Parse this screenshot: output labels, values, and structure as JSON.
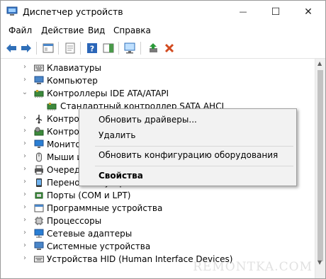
{
  "window": {
    "title": "Диспетчер устройств",
    "minimize": "—",
    "maximize": "☐",
    "close": "✕"
  },
  "menu": [
    "Файл",
    "Действие",
    "Вид",
    "Справка"
  ],
  "tree": [
    {
      "label": "Клавиатуры",
      "state": "collapsed",
      "icon": "keyboard-icon"
    },
    {
      "label": "Компьютер",
      "state": "collapsed",
      "icon": "computer-icon"
    },
    {
      "label": "Контроллеры IDE ATA/ATAPI",
      "state": "expanded",
      "icon": "ide-controller-icon"
    },
    {
      "label": "Стандартный контроллер SATA AHCI",
      "state": "child",
      "icon": "sata-controller-icon"
    },
    {
      "label": "Контроллеры USB",
      "state": "collapsed",
      "icon": "usb-icon"
    },
    {
      "label": "Контроллеры запоминающих устройств",
      "state": "collapsed",
      "icon": "storage-controller-icon"
    },
    {
      "label": "Мониторы",
      "state": "collapsed",
      "icon": "monitor-icon"
    },
    {
      "label": "Мыши и иные указывающие устройства",
      "state": "collapsed",
      "icon": "mouse-icon"
    },
    {
      "label": "Очереди печати",
      "state": "collapsed",
      "icon": "printer-icon"
    },
    {
      "label": "Переносные устройства",
      "state": "collapsed",
      "icon": "portable-device-icon"
    },
    {
      "label": "Порты (COM и LPT)",
      "state": "collapsed",
      "icon": "port-icon"
    },
    {
      "label": "Программные устройства",
      "state": "collapsed",
      "icon": "software-device-icon"
    },
    {
      "label": "Процессоры",
      "state": "collapsed",
      "icon": "processor-icon"
    },
    {
      "label": "Сетевые адаптеры",
      "state": "collapsed",
      "icon": "network-adapter-icon"
    },
    {
      "label": "Системные устройства",
      "state": "collapsed",
      "icon": "system-device-icon"
    },
    {
      "label": "Устройства HID (Human Interface Devices)",
      "state": "collapsed",
      "icon": "hid-icon"
    }
  ],
  "context_menu": {
    "update_drivers": "Обновить драйверы...",
    "remove": "Удалить",
    "scan_hardware": "Обновить конфигурацию оборудования",
    "properties": "Свойства"
  },
  "watermark": "REMONTKA.COM",
  "colors": {
    "accent": "#1e7fd8",
    "remove_red": "#d24a1f",
    "update_green": "#2a9a38"
  }
}
